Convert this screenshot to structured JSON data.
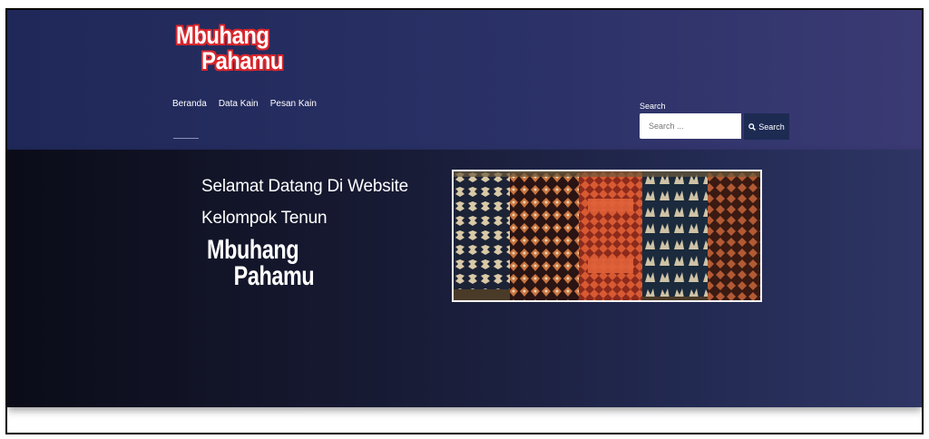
{
  "brand": {
    "line1": "Mbuhang",
    "line2": "Pahamu"
  },
  "nav": {
    "items": [
      "Beranda",
      "Data Kain",
      "Pesan Kain"
    ]
  },
  "search": {
    "label": "Search",
    "placeholder": "Search ...",
    "button_label": "Search",
    "icon": "search-icon"
  },
  "hero": {
    "line1": "Selamat Datang Di Website",
    "line2": "Kelompok Tenun",
    "logo_line1": "Mbuhang",
    "logo_line2": "Pahamu",
    "image": "woven-ikat-textiles-photo"
  },
  "colors": {
    "header": "#2a3166",
    "hero": "#171a33",
    "button": "#1d2b53",
    "logo_outline": "#d8272d"
  }
}
